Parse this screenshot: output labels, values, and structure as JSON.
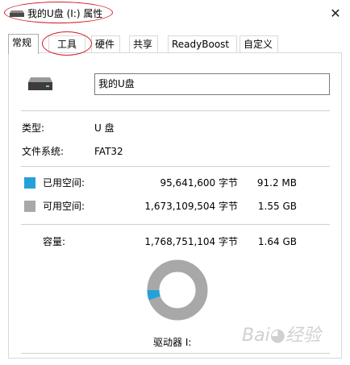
{
  "window": {
    "title": "我的U盘 (I:) 属性",
    "close_label": "✕"
  },
  "tabs": [
    {
      "label": "常规",
      "selected": true
    },
    {
      "label": "工具",
      "selected": false
    },
    {
      "label": "硬件",
      "selected": false
    },
    {
      "label": "共享",
      "selected": false
    },
    {
      "label": "ReadyBoost",
      "selected": false
    },
    {
      "label": "自定义",
      "selected": false
    }
  ],
  "general": {
    "volume_name": "我的U盘",
    "type_label": "类型:",
    "type_value": "U 盘",
    "fs_label": "文件系统:",
    "fs_value": "FAT32",
    "used": {
      "label": "已用空间:",
      "bytes": "95,641,600 字节",
      "size": "91.2 MB",
      "color": "#26a0da"
    },
    "free": {
      "label": "可用空间:",
      "bytes": "1,673,109,504 字节",
      "size": "1.55 GB",
      "color": "#a8a8a8"
    },
    "capacity": {
      "label": "容量:",
      "bytes": "1,768,751,104 字节",
      "size": "1.64 GB"
    },
    "used_fraction": 0.054,
    "drive_label": "驱动器 I:"
  },
  "watermark": "Baidu"
}
